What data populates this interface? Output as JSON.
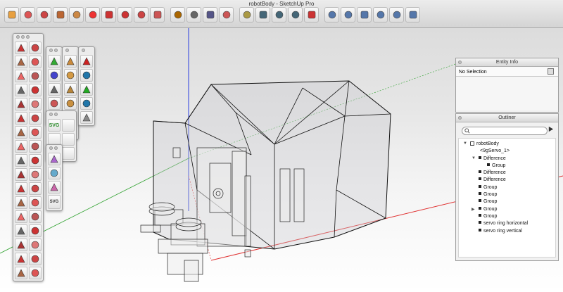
{
  "window": {
    "title": "robotBody - SketchUp Pro"
  },
  "toolbar": {
    "tools": [
      "select-arrow",
      "eraser",
      "pencil-line",
      "arc",
      "push-pull",
      "follow-me",
      "rotate",
      "move",
      "scale",
      "offset",
      "tape-measure",
      "text-label",
      "paint-bucket",
      "orbit",
      "pan",
      "zoom",
      "zoom-extents",
      "previous-view",
      "add-location",
      "iso-view",
      "top-view",
      "front-view",
      "right-view",
      "back-view",
      "left-view"
    ]
  },
  "entity_info": {
    "title": "Entity Info",
    "selection": "No Selection"
  },
  "outliner": {
    "title": "Outliner",
    "search_placeholder": "",
    "items": [
      {
        "label": "robotBody",
        "depth": 0,
        "expand": "open",
        "icon": "model"
      },
      {
        "label": "<9gServo_1>",
        "depth": 1,
        "expand": "none",
        "icon": "component"
      },
      {
        "label": "Difference",
        "depth": 1,
        "expand": "open",
        "icon": "group"
      },
      {
        "label": "Group",
        "depth": 2,
        "expand": "none",
        "icon": "group"
      },
      {
        "label": "Difference",
        "depth": 1,
        "expand": "none",
        "icon": "group"
      },
      {
        "label": "Difference",
        "depth": 1,
        "expand": "none",
        "icon": "group"
      },
      {
        "label": "Group",
        "depth": 1,
        "expand": "none",
        "icon": "group"
      },
      {
        "label": "Group",
        "depth": 1,
        "expand": "none",
        "icon": "group"
      },
      {
        "label": "Group",
        "depth": 1,
        "expand": "none",
        "icon": "group"
      },
      {
        "label": "Group",
        "depth": 1,
        "expand": "closed",
        "icon": "group"
      },
      {
        "label": "Group",
        "depth": 1,
        "expand": "none",
        "icon": "group"
      },
      {
        "label": "servo ring horizontal",
        "depth": 1,
        "expand": "none",
        "icon": "group"
      },
      {
        "label": "servo ring vertical",
        "depth": 1,
        "expand": "none",
        "icon": "group"
      }
    ]
  },
  "palettes": {
    "svg_label": "SVG",
    "svg_small_label": "SVG"
  },
  "colors": {
    "axis_red": "#e03030",
    "axis_green": "#2ca02c",
    "axis_blue": "#2a3de0"
  }
}
